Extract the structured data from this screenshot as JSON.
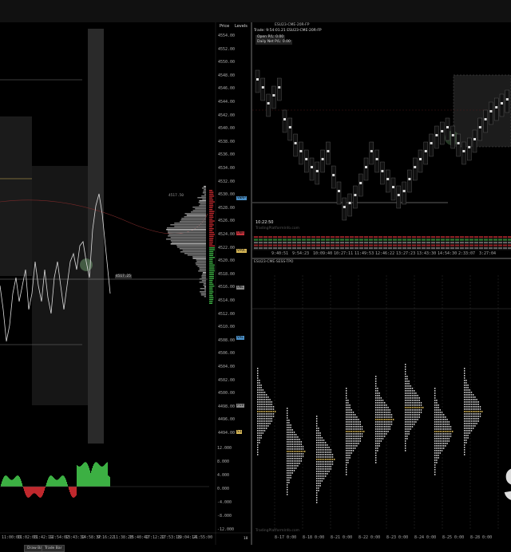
{
  "colors": {
    "up": "#3cb043",
    "down": "#c0282d",
    "grid": "#262626",
    "bg": "#000000",
    "accent": "#d6b656"
  },
  "left_chart": {
    "price_header": "Price",
    "levels_header": "Levels",
    "prices": [
      "4554.00",
      "4552.00",
      "4550.00",
      "4548.00",
      "4546.00",
      "4544.00",
      "4542.00",
      "4540.00",
      "4538.00",
      "4536.00",
      "4534.00",
      "4532.00",
      "4530.00",
      "4528.00",
      "4526.00",
      "4524.00",
      "4522.00",
      "4520.00",
      "4518.00",
      "4516.00",
      "4514.00",
      "4512.00",
      "4510.00",
      "4508.00",
      "4506.00",
      "4504.00",
      "4502.00",
      "4500.00",
      "4498.00",
      "4496.00",
      "4494.00"
    ],
    "osc_ticks": [
      "12.000",
      "8.000",
      "4.000",
      "0.000",
      "-4.000",
      "-8.000",
      "-12.000"
    ],
    "times": [
      "11:00:00",
      "11:02:03",
      "11:42:19",
      "12:54:02",
      "13:43:32",
      "14:58:37",
      "9:16:22",
      "11:38:28",
      "15:40:42",
      "17:12:22",
      "17:53:18",
      "19:04:14",
      "21:55:00"
    ],
    "level_tags": [
      {
        "label": "VWAP",
        "color": "#4a90c8"
      },
      {
        "label": "ONH",
        "color": "#c8323c"
      },
      {
        "label": "VPOC",
        "color": "#d6b656"
      },
      {
        "label": "ONL",
        "color": "#888888"
      },
      {
        "label": "VAL",
        "color": "#4a90c8"
      },
      {
        "label": "PIV",
        "color": "#888888"
      },
      {
        "label": "S1",
        "color": "#d6b656"
      }
    ],
    "price_marker": "4517.25",
    "tp_note": "4517.50",
    "right_note": "18"
  },
  "right_top": {
    "title": "ESU23-CME-20R-FP",
    "trade_line": "Trade: 9:54:01.21  ESU23-CME-20R-FP",
    "open_pl": "Open P/L: 0.00",
    "daily_pl": "Daily Net P/L: 0.00",
    "clock": "10:22:50",
    "watermark": "TradingPlatformInfo.com",
    "times": [
      "9:40:51",
      "9:54:23",
      "10:09:40",
      "10:27:11",
      "11:49:53",
      "12:46:22",
      "13:27:23",
      "13:43:30",
      "14:54:30",
      "2:33:07",
      "3:27:04"
    ]
  },
  "right_bottom": {
    "title": "ESU23-CME-SESS-TPO",
    "watermark": "TradingPlatformInfo.com",
    "dates": [
      "8-17  0:00",
      "8-18  0:00",
      "8-21  0:00",
      "8-22  0:00",
      "8-23  0:00",
      "8-24  0:00",
      "8-25  0:00",
      "8-28  0:00"
    ]
  },
  "bottom_buttons": [
    "Draw Bar",
    "Trade Bar"
  ],
  "big_letter": "S"
}
